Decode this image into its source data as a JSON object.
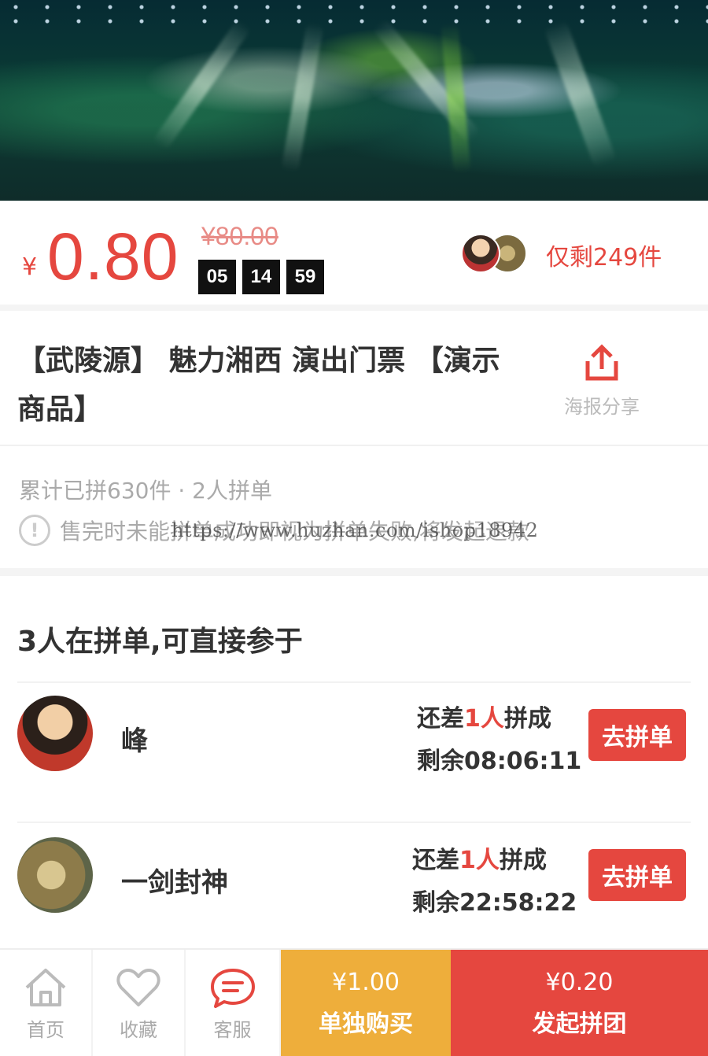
{
  "product": {
    "currency": "¥",
    "price": "0.80",
    "original_price": "¥80.00",
    "countdown": [
      "05",
      "14",
      "59"
    ],
    "remaining": "仅剩249件",
    "title": "【武陵源】 魅力湘西 演出门票 【演示商品】",
    "share_label": "海报分享"
  },
  "info": {
    "stats": "累计已拼630件 · 2人拼单",
    "notice": "售完时未能拼单成功即视为拼单失败,将发起退款",
    "watermark": "https://www.huzhan.com/ishop18942"
  },
  "groups": {
    "title": "3人在拼单,可直接参于",
    "items": [
      {
        "name": "峰",
        "need_prefix": "还差",
        "need_count": "1人",
        "need_suffix": "拼成",
        "time": "剩余08:06:11",
        "button": "去拼单"
      },
      {
        "name": "一剑封神",
        "need_prefix": "还差",
        "need_count": "1人",
        "need_suffix": "拼成",
        "time": "剩余22:58:22",
        "button": "去拼单"
      }
    ]
  },
  "bottom_bar": {
    "home": "首页",
    "favorite": "收藏",
    "service": "客服",
    "solo_price": "¥1.00",
    "solo_label": "单独购买",
    "group_price": "¥0.20",
    "group_label": "发起拼团"
  },
  "colors": {
    "accent": "#e5473f",
    "solo": "#eeae3b"
  }
}
